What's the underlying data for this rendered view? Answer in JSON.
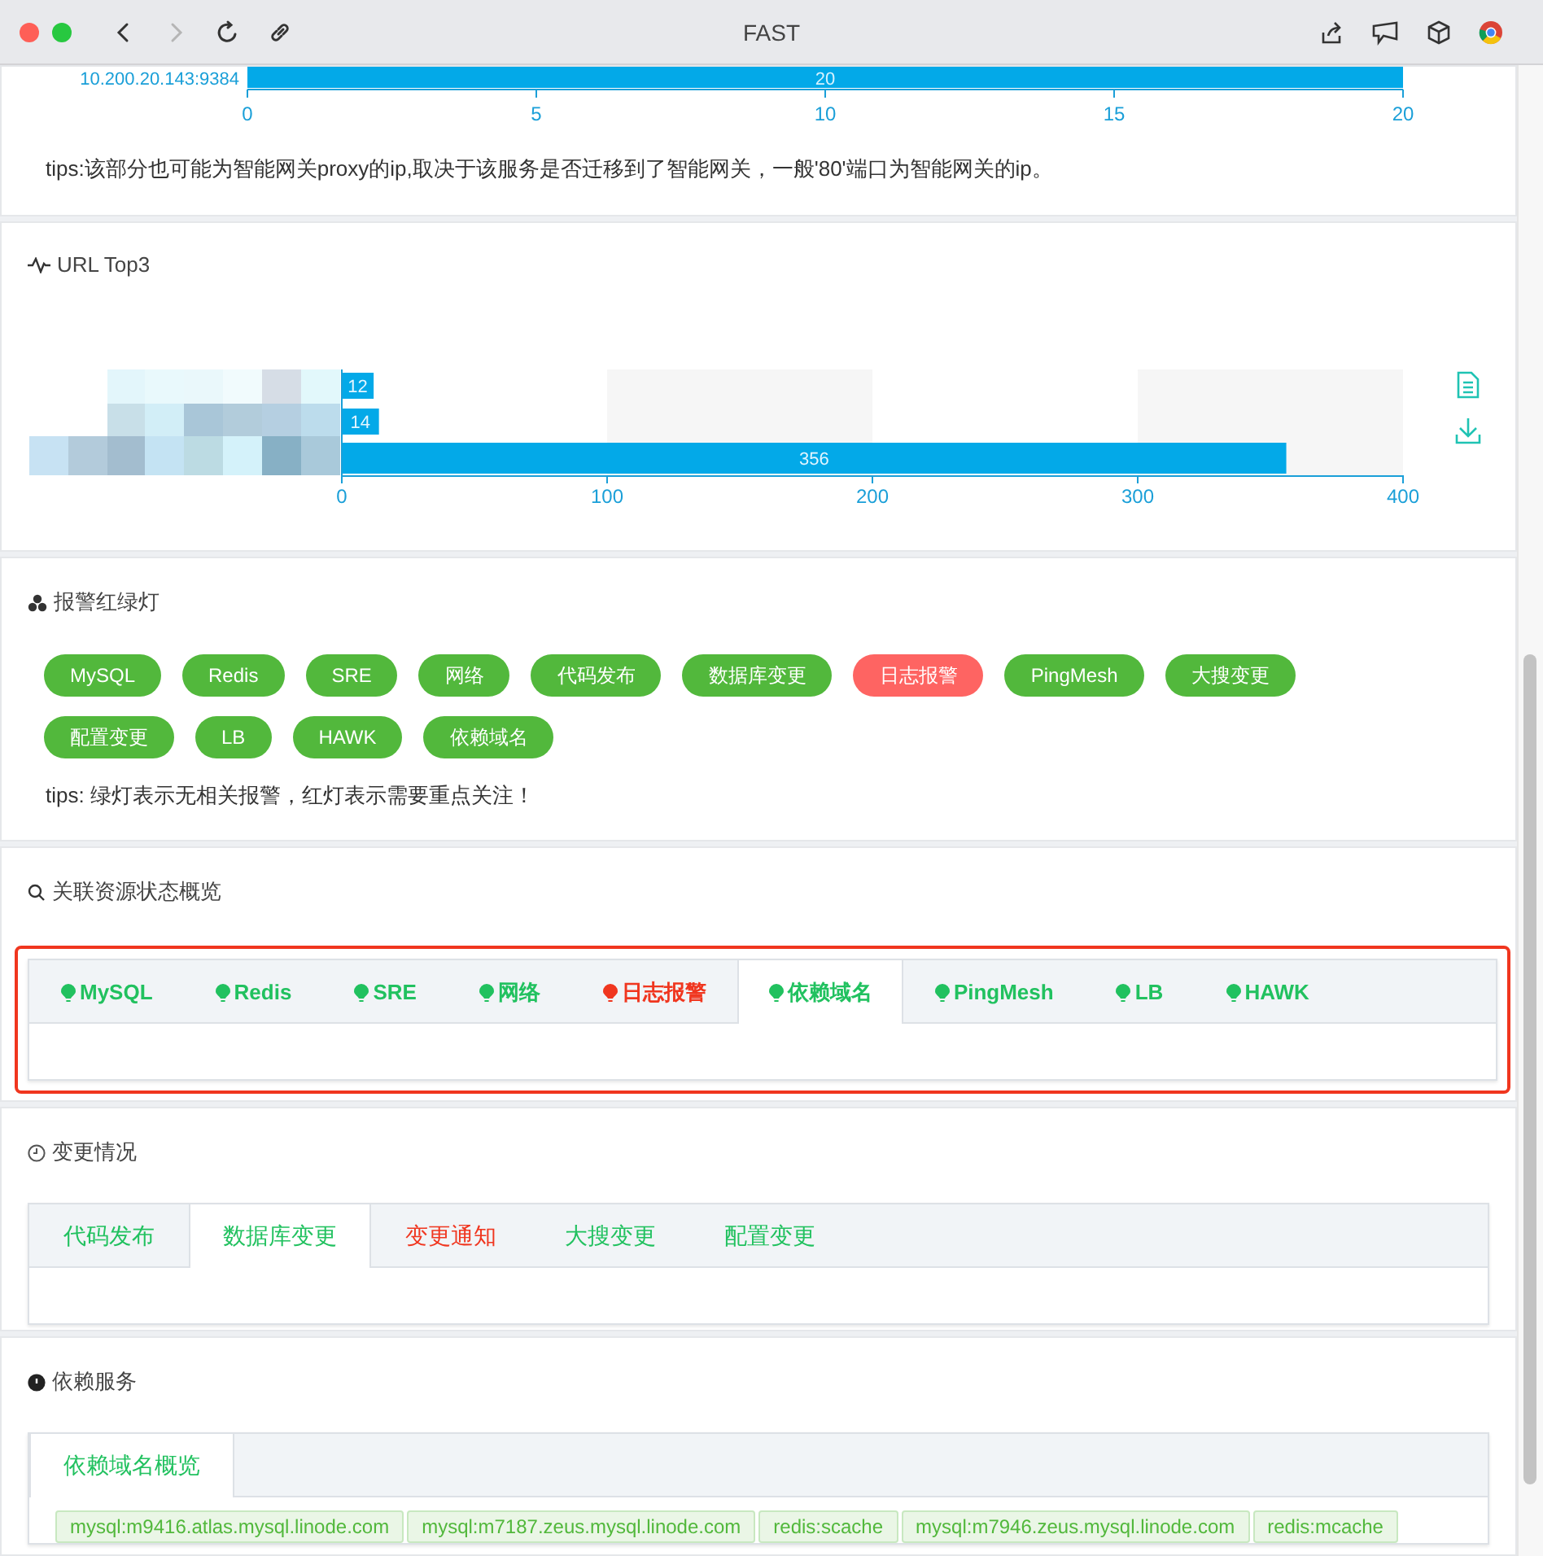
{
  "window": {
    "title": "FAST"
  },
  "nav_buttons": [
    {
      "kind": "back",
      "disabled": false
    },
    {
      "kind": "forward",
      "disabled": true
    },
    {
      "kind": "reload",
      "disabled": false
    },
    {
      "kind": "link",
      "disabled": false
    }
  ],
  "ip_chart": {
    "chart_data": {
      "type": "bar",
      "orientation": "horizontal",
      "categories": [
        "10.200.20.143:9384"
      ],
      "values": [
        20
      ],
      "xlim": [
        0,
        20
      ],
      "xticks": [
        0,
        5,
        10,
        15,
        20
      ],
      "data_labels": true
    },
    "tips": "tips:该部分也可能为智能网关proxy的ip,取决于该服务是否迁移到了智能网关，一般'80'端口为智能网关的ip。"
  },
  "url_top3": {
    "title": "URL Top3",
    "chart_data": {
      "type": "bar",
      "orientation": "horizontal",
      "values": [
        12,
        14,
        356
      ],
      "xlim": [
        0,
        400
      ],
      "xticks": [
        0,
        100,
        200,
        300,
        400
      ],
      "data_labels": true
    }
  },
  "alarm_lights": {
    "title": "报警红绿灯",
    "lights": [
      {
        "label": "MySQL",
        "alarm": false
      },
      {
        "label": "Redis",
        "alarm": false
      },
      {
        "label": "SRE",
        "alarm": false
      },
      {
        "label": "网络",
        "alarm": false
      },
      {
        "label": "代码发布",
        "alarm": false
      },
      {
        "label": "数据库变更",
        "alarm": false
      },
      {
        "label": "日志报警",
        "alarm": true
      },
      {
        "label": "PingMesh",
        "alarm": false
      },
      {
        "label": "大搜变更",
        "alarm": false
      },
      {
        "label": "配置变更",
        "alarm": false
      },
      {
        "label": "LB",
        "alarm": false
      },
      {
        "label": "HAWK",
        "alarm": false
      },
      {
        "label": "依赖域名",
        "alarm": false
      }
    ],
    "tips": "tips: 绿灯表示无相关报警，红灯表示需要重点关注！"
  },
  "resource_status": {
    "title": "关联资源状态概览",
    "highlighted": true,
    "tabs": [
      {
        "label": "MySQL",
        "alarm": false,
        "selected": false
      },
      {
        "label": "Redis",
        "alarm": false,
        "selected": false
      },
      {
        "label": "SRE",
        "alarm": false,
        "selected": false
      },
      {
        "label": "网络",
        "alarm": false,
        "selected": false
      },
      {
        "label": "日志报警",
        "alarm": true,
        "selected": false
      },
      {
        "label": "依赖域名",
        "alarm": false,
        "selected": true
      },
      {
        "label": "PingMesh",
        "alarm": false,
        "selected": false
      },
      {
        "label": "LB",
        "alarm": false,
        "selected": false
      },
      {
        "label": "HAWK",
        "alarm": false,
        "selected": false
      }
    ]
  },
  "changes": {
    "title": "变更情况",
    "tabs": [
      {
        "label": "代码发布",
        "alarm": false,
        "selected": false
      },
      {
        "label": "数据库变更",
        "alarm": false,
        "selected": true
      },
      {
        "label": "变更通知",
        "alarm": true,
        "selected": false
      },
      {
        "label": "大搜变更",
        "alarm": false,
        "selected": false
      },
      {
        "label": "配置变更",
        "alarm": false,
        "selected": false
      }
    ]
  },
  "dependencies": {
    "title": "依赖服务",
    "tabs": [
      {
        "label": "依赖域名概览",
        "selected": true
      }
    ],
    "domains": [
      "mysql:m9416.atlas.mysql.linode.com",
      "mysql:m7187.zeus.mysql.linode.com",
      "redis:scache",
      "mysql:m7946.zeus.mysql.linode.com",
      "redis:mcache"
    ]
  }
}
